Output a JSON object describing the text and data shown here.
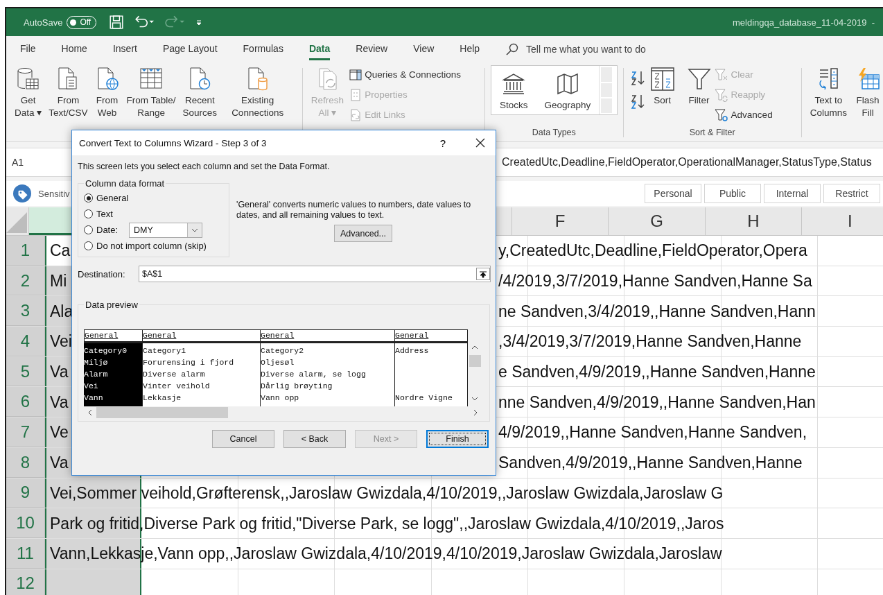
{
  "title_bar": {
    "autosave_label": "AutoSave",
    "autosave": {
      "on": false,
      "label": "Off"
    },
    "quick_access": [
      {
        "disabled": false
      },
      {
        "disabled": false
      },
      {
        "disabled": true
      },
      {
        "disabled": false
      }
    ],
    "title": "meldingqa_database_11-04-2019  -"
  },
  "tabs": [
    {
      "label": "File",
      "selected": false
    },
    {
      "label": "Home",
      "selected": false
    },
    {
      "label": "Insert",
      "selected": false
    },
    {
      "label": "Page Layout",
      "selected": false
    },
    {
      "label": "Formulas",
      "selected": false
    },
    {
      "label": "Data",
      "selected": true
    },
    {
      "label": "Review",
      "selected": false
    },
    {
      "label": "View",
      "selected": false
    },
    {
      "label": "Help",
      "selected": false
    }
  ],
  "tell_me": {
    "placeholder": "Tell me what you want to do"
  },
  "ribbon": {
    "get_transform": [
      {
        "lines": [
          "Get",
          "Data ▾"
        ]
      },
      {
        "lines": [
          "From",
          "Text/CSV"
        ]
      },
      {
        "lines": [
          "From",
          "Web"
        ]
      },
      {
        "lines": [
          "From Table/",
          "Range"
        ]
      },
      {
        "lines": [
          "Recent",
          "Sources"
        ]
      },
      {
        "lines": [
          "Existing",
          "Connections"
        ]
      }
    ],
    "refresh": {
      "lines": [
        "Refresh",
        "All ▾"
      ],
      "disabled": true
    },
    "queries": [
      {
        "label": "Queries & Connections",
        "disabled": false
      },
      {
        "label": "Properties",
        "disabled": true
      },
      {
        "label": "Edit Links",
        "disabled": true
      }
    ],
    "data_types": {
      "items": [
        "Stocks",
        "Geography"
      ],
      "label": "Data Types"
    },
    "sort_filter": {
      "sort": "Sort",
      "filter": "Filter",
      "items": [
        {
          "label": "Clear",
          "disabled": true
        },
        {
          "label": "Reapply",
          "disabled": true
        },
        {
          "label": "Advanced",
          "disabled": false
        }
      ],
      "label": "Sort & Filter"
    },
    "data_tools": [
      {
        "lines": [
          "Text to",
          "Columns"
        ]
      },
      {
        "lines": [
          "Flash",
          "Fill"
        ]
      }
    ]
  },
  "formula_bar": {
    "name_box": "A1",
    "formula": "CreatedUtc,Deadline,FieldOperator,OperationalManager,StatusType,Status"
  },
  "sensitivity": {
    "label": "Sensitiv",
    "labels": [
      "Personal",
      "Public",
      "Internal",
      "Restrict"
    ]
  },
  "sheet": {
    "columns": [
      {
        "selected": true
      },
      {
        "label": "F",
        "selected": false
      },
      {
        "label": "G",
        "selected": false
      },
      {
        "label": "H",
        "selected": false
      },
      {
        "label": "I",
        "selected": false
      }
    ],
    "rows": [
      {
        "number": "1",
        "active": true,
        "left": "Ca",
        "right": "y,CreatedUtc,Deadline,FieldOperator,Opera"
      },
      {
        "number": "2",
        "active": false,
        "left": "Mi",
        "right": "/4/2019,3/7/2019,Hanne Sandven,Hanne Sa"
      },
      {
        "number": "3",
        "active": false,
        "left": "Ala",
        "right": "ne Sandven,3/4/2019,,Hanne Sandven,Hann"
      },
      {
        "number": "4",
        "active": false,
        "left": "Vei",
        "right": ",3/4/2019,3/7/2019,Hanne Sandven,Hanne"
      },
      {
        "number": "5",
        "active": false,
        "left": "Va",
        "right": "e Sandven,4/9/2019,,Hanne Sandven,Hanne"
      },
      {
        "number": "6",
        "active": false,
        "left": "Va",
        "right": "nne Sandven,4/9/2019,,Hanne Sandven,Han"
      },
      {
        "number": "7",
        "active": false,
        "left": "Ve",
        "right": "4/9/2019,,Hanne Sandven,Hanne Sandven,"
      },
      {
        "number": "8",
        "active": false,
        "left": "Va",
        "right": "Sandven,4/9/2019,,Hanne Sandven,Hanne"
      },
      {
        "number": "9",
        "active": false,
        "text": "Vei,Sommer veihold,Grøfterensk,,Jaroslaw Gwizdala,4/10/2019,,Jaroslaw Gwizdala,Jaroslaw G"
      },
      {
        "number": "10",
        "active": false,
        "text": "Park og fritid,Diverse Park og fritid,\"Diverse Park, se logg\",,Jaroslaw Gwizdala,4/10/2019,,Jaros"
      },
      {
        "number": "11",
        "active": false,
        "text": "Vann,Lekkasje,Vann opp,,Jaroslaw Gwizdala,4/10/2019,4/10/2019,Jaroslaw Gwizdala,Jaroslaw"
      },
      {
        "number": "12",
        "active": false
      }
    ]
  },
  "dialog": {
    "title": "Convert Text to Columns Wizard - Step 3 of 3",
    "help": "?",
    "intro": "This screen lets you select each column and set the Data Format.",
    "format_group": {
      "legend": "Column data format",
      "options": [
        {
          "label": "General",
          "selected": true
        },
        {
          "label": "Text",
          "selected": false
        },
        {
          "label": "Date:",
          "selected": false,
          "kind": "date",
          "value": "DMY"
        },
        {
          "label": "Do not import column (skip)",
          "selected": false
        }
      ]
    },
    "description": "'General' converts numeric values to numbers, date values to dates, and all remaining values to text.",
    "advanced_button": "Advanced...",
    "destination": {
      "label": "Destination:",
      "value": "$A$1"
    },
    "preview": {
      "legend": "Data preview",
      "columns": [
        {
          "format": "General",
          "selected": true,
          "cells": [
            "Category0",
            "Miljø",
            "Alarm",
            "Vei",
            "Vann"
          ]
        },
        {
          "format": "General",
          "selected": false,
          "cells": [
            "Category1",
            "Forurensing i fjord",
            "Diverse alarm",
            "Vinter veihold",
            "Lekkasje"
          ]
        },
        {
          "format": "General",
          "selected": false,
          "cells": [
            "Category2",
            "Oljesøl",
            "Diverse alarm, se logg",
            "Dårlig brøyting",
            "Vann opp"
          ]
        },
        {
          "format": "General",
          "selected": false,
          "cells": [
            "Address",
            null,
            null,
            null,
            "Nordre Vigne"
          ]
        }
      ]
    },
    "buttons": [
      {
        "label": "Cancel",
        "disabled": false,
        "default": false
      },
      {
        "label": "< Back",
        "disabled": false,
        "default": false
      },
      {
        "label": "Next >",
        "disabled": true,
        "default": false
      },
      {
        "label": "Finish",
        "disabled": false,
        "default": true
      }
    ]
  }
}
